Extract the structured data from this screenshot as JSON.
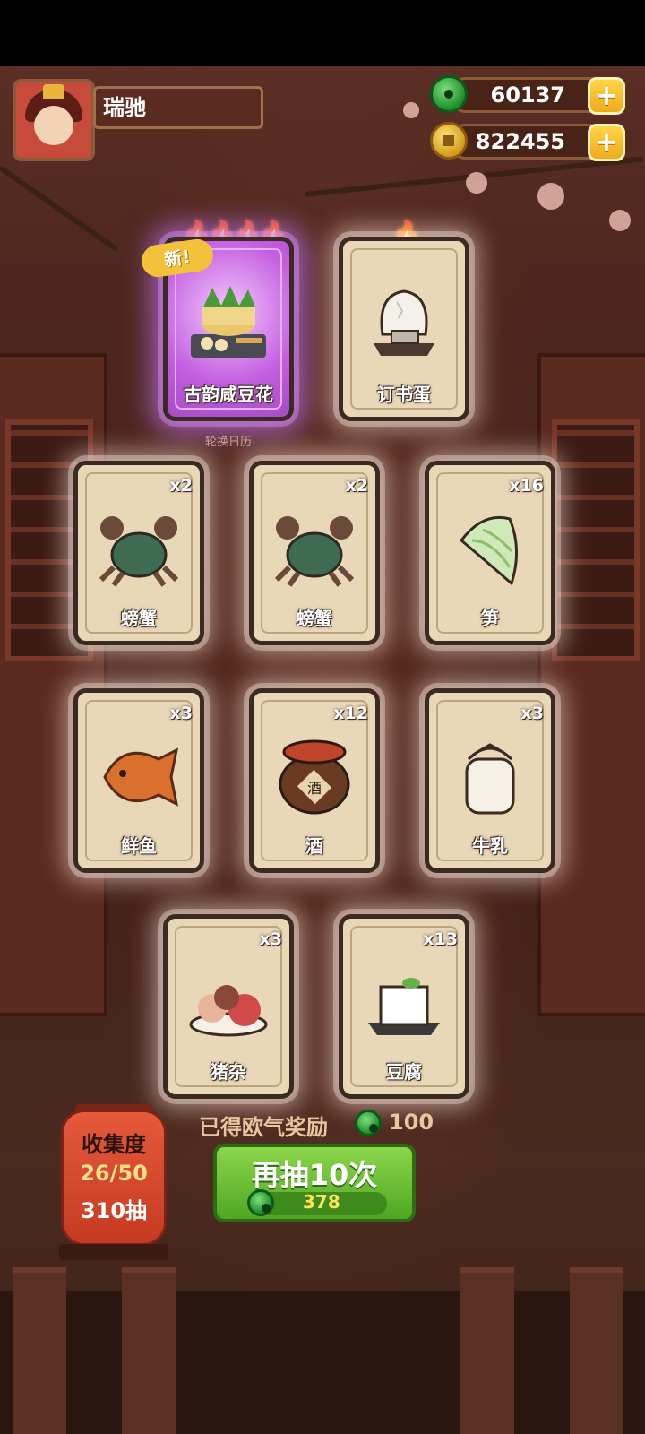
{
  "profile": {
    "name": "瑞驰"
  },
  "currency": {
    "jade": "60137",
    "coins": "822455",
    "add_label": "+"
  },
  "featured": [
    {
      "name": "古韵咸豆花",
      "stars": "🔥🔥🔥🔥",
      "rarity": "purple",
      "badge": "新!",
      "art": "dish-icon"
    },
    {
      "name": "订书蛋",
      "stars": "🔥",
      "rarity": "normal",
      "art": "egg-icon"
    }
  ],
  "calendar_label": "轮换日历",
  "items": [
    {
      "name": "螃蟹",
      "count": "x2",
      "art": "crab-icon"
    },
    {
      "name": "螃蟹",
      "count": "x2",
      "art": "crab-icon"
    },
    {
      "name": "笋",
      "count": "x16",
      "art": "bamboo-shoot-icon"
    },
    {
      "name": "鲜鱼",
      "count": "x3",
      "art": "fish-icon"
    },
    {
      "name": "酒",
      "count": "x12",
      "art": "wine-jar-icon"
    },
    {
      "name": "牛乳",
      "count": "x3",
      "art": "milk-jar-icon"
    },
    {
      "name": "猪杂",
      "count": "x3",
      "art": "pork-icon"
    },
    {
      "name": "豆腐",
      "count": "x13",
      "art": "tofu-icon"
    }
  ],
  "jar_label": "酒",
  "reward": {
    "label": "已得欧气奖励",
    "value": "100"
  },
  "draw": {
    "label": "再抽10次",
    "cost": "378"
  },
  "collection": {
    "title": "收集度",
    "progress": "26/50",
    "draws": "310抽"
  },
  "colors": {
    "jade": "#1f8d2b",
    "gold": "#f0a91c",
    "button_green": "#4fa722",
    "card_bg": "#e9d8b8",
    "rare_purple": "#c35ee0"
  }
}
